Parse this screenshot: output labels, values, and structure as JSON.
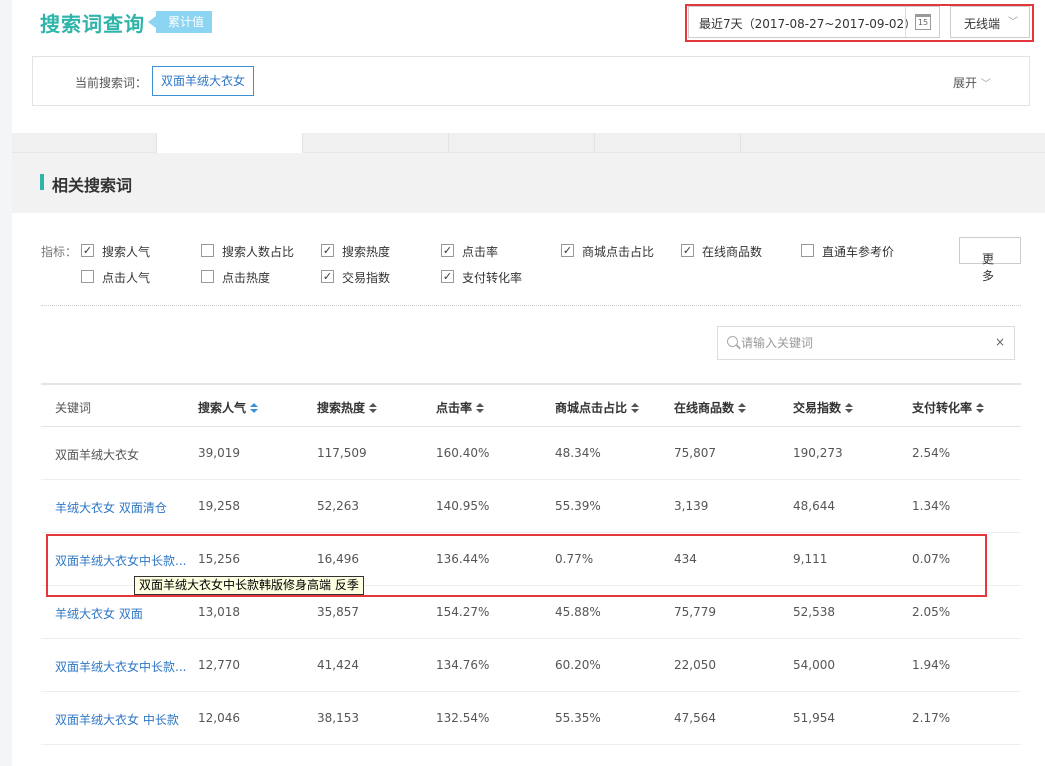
{
  "header": {
    "title": "搜索词查询",
    "badge": "累计值",
    "date_range": "最近7天（2017-08-27~2017-09-02）",
    "calendar_day": "15",
    "device": "无线端",
    "current_keyword_label": "当前搜索词：",
    "current_keyword": "双面羊绒大衣女",
    "expand_label": "展开"
  },
  "section": {
    "title": "相关搜索词"
  },
  "indicators": {
    "label": "指标：",
    "items": [
      {
        "label": "搜索人气",
        "checked": true
      },
      {
        "label": "搜索人数占比",
        "checked": false
      },
      {
        "label": "搜索热度",
        "checked": true
      },
      {
        "label": "点击率",
        "checked": true
      },
      {
        "label": "商城点击占比",
        "checked": true
      },
      {
        "label": "在线商品数",
        "checked": true
      },
      {
        "label": "直通车参考价",
        "checked": false
      },
      {
        "label": "点击人气",
        "checked": false
      },
      {
        "label": "点击热度",
        "checked": false
      },
      {
        "label": "交易指数",
        "checked": true
      },
      {
        "label": "支付转化率",
        "checked": true
      }
    ],
    "more_label": "更多"
  },
  "search": {
    "placeholder": "请输入关键词",
    "clear": "×"
  },
  "table": {
    "headers": [
      "关键词",
      "搜索人气",
      "搜索热度",
      "点击率",
      "商城点击占比",
      "在线商品数",
      "交易指数",
      "支付转化率"
    ],
    "rows": [
      [
        "双面羊绒大衣女",
        "39,019",
        "117,509",
        "160.40%",
        "48.34%",
        "75,807",
        "190,273",
        "2.54%"
      ],
      [
        "羊绒大衣女 双面清仓",
        "19,258",
        "52,263",
        "140.95%",
        "55.39%",
        "3,139",
        "48,644",
        "1.34%"
      ],
      [
        "双面羊绒大衣女中长款...",
        "15,256",
        "16,496",
        "136.44%",
        "0.77%",
        "434",
        "9,111",
        "0.07%"
      ],
      [
        "羊绒大衣女 双面",
        "13,018",
        "35,857",
        "154.27%",
        "45.88%",
        "75,779",
        "52,538",
        "2.05%"
      ],
      [
        "双面羊绒大衣女中长款...",
        "12,770",
        "41,424",
        "134.76%",
        "60.20%",
        "22,050",
        "54,000",
        "1.94%"
      ],
      [
        "双面羊绒大衣女 中长款",
        "12,046",
        "38,153",
        "132.54%",
        "55.35%",
        "47,564",
        "51,954",
        "2.17%"
      ]
    ]
  },
  "tooltip": "双面羊绒大衣女中长款韩版修身高端 反季",
  "colors": {
    "accent": "#2fb4a9",
    "link": "#2f77c4",
    "highlight": "#e5363b",
    "badge": "#8bd4f2"
  }
}
